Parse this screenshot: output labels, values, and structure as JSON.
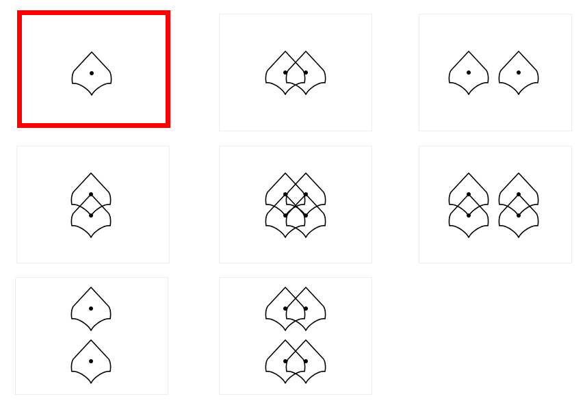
{
  "grid": {
    "selected_index": 0,
    "selection_color": "#ff0000",
    "icon": "pentagon-shield-icon",
    "tiles": [
      {
        "name": "tile-single"
      },
      {
        "name": "tile-two-overlapping-horizontal"
      },
      {
        "name": "tile-two-separated-horizontal"
      },
      {
        "name": "tile-two-overlapping-vertical"
      },
      {
        "name": "tile-four-overlapping-grid"
      },
      {
        "name": "tile-four-pairs-vertical"
      },
      {
        "name": "tile-two-separated-vertical"
      },
      {
        "name": "tile-four-pairs-horizontal"
      }
    ]
  }
}
